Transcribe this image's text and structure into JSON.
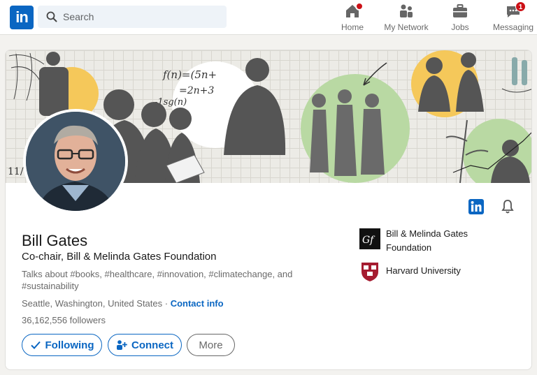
{
  "app": {
    "name": "LinkedIn",
    "logo_text": "in"
  },
  "search": {
    "placeholder": "Search",
    "icon": "search-icon"
  },
  "nav": {
    "items": [
      {
        "label": "Home",
        "icon": "home-icon",
        "notification_dot": true
      },
      {
        "label": "My Network",
        "icon": "network-icon"
      },
      {
        "label": "Jobs",
        "icon": "briefcase-icon"
      },
      {
        "label": "Messaging",
        "icon": "messaging-icon",
        "badge": "1"
      }
    ]
  },
  "profile": {
    "name": "Bill Gates",
    "headline": "Co-chair, Bill & Melinda Gates Foundation",
    "talks_about": "Talks about #books, #healthcare, #innovation, #climatechange, and #sustainability",
    "location": "Seattle, Washington, United States",
    "location_separator": " · ",
    "contact_info_label": "Contact info",
    "followers": "36,162,556 followers",
    "organizations": [
      {
        "name": "Bill & Melinda Gates Foundation",
        "logo_text": "Gf"
      },
      {
        "name": "Harvard University",
        "logo_text": "VE RI TAS"
      }
    ],
    "buttons": {
      "following": "Following",
      "connect": "Connect",
      "more": "More"
    },
    "icons": {
      "linkedin_badge": "linkedin-badge-icon",
      "bell": "bell-icon"
    }
  },
  "colors": {
    "brand": "#0a66c2",
    "badge": "#cc1016",
    "background": "#f3f2ef"
  }
}
